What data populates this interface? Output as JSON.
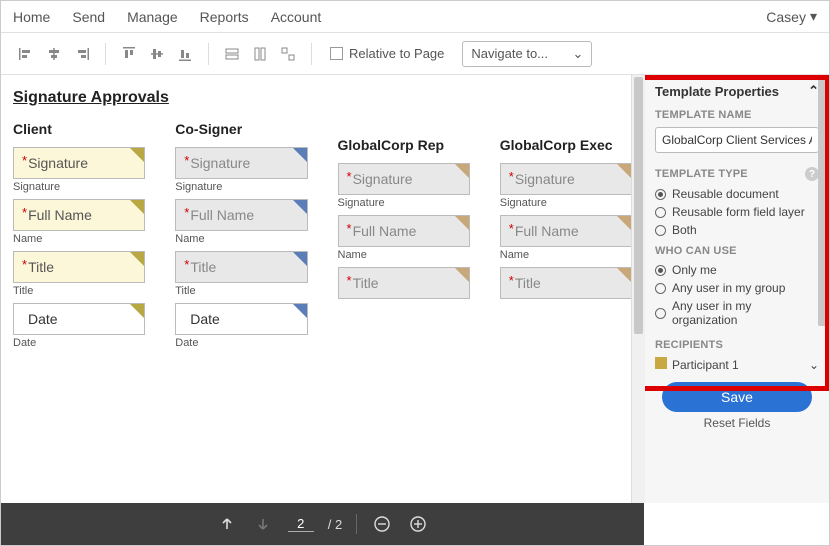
{
  "topnav": {
    "items": [
      "Home",
      "Send",
      "Manage",
      "Reports",
      "Account"
    ],
    "user": "Casey"
  },
  "toolbar": {
    "relative_label": "Relative to Page",
    "navigate_label": "Navigate to..."
  },
  "doc": {
    "section_title": "Signature Approvals",
    "roles": [
      {
        "label": "Client",
        "tone": "yellow",
        "corner": "c-olive",
        "fields": [
          {
            "ph": "Signature",
            "req": true,
            "sub": "Signature"
          },
          {
            "ph": "Full Name",
            "req": true,
            "sub": "Name"
          },
          {
            "ph": "Title",
            "req": true,
            "sub": "Title"
          },
          {
            "ph": "Date",
            "req": false,
            "sub": "Date",
            "tone_override": "white",
            "indent": true
          }
        ]
      },
      {
        "label": "Co-Signer",
        "tone": "grey",
        "corner": "c-blue",
        "fields": [
          {
            "ph": "Signature",
            "req": true,
            "sub": "Signature"
          },
          {
            "ph": "Full Name",
            "req": true,
            "sub": "Name"
          },
          {
            "ph": "Title",
            "req": true,
            "sub": "Title"
          },
          {
            "ph": "Date",
            "req": false,
            "sub": "Date",
            "tone_override": "white",
            "indent": true
          }
        ]
      },
      {
        "label": "GlobalCorp Rep",
        "tone": "grey",
        "corner": "c-tan",
        "fields": [
          {
            "ph": "Signature",
            "req": true,
            "sub": "Signature"
          },
          {
            "ph": "Full Name",
            "req": true,
            "sub": "Name"
          },
          {
            "ph": "Title",
            "req": true,
            "sub": ""
          }
        ]
      },
      {
        "label": "GlobalCorp Exec",
        "tone": "grey",
        "corner": "c-tan",
        "fields": [
          {
            "ph": "Signature",
            "req": true,
            "sub": "Signature"
          },
          {
            "ph": "Full Name",
            "req": true,
            "sub": "Name"
          },
          {
            "ph": "Title",
            "req": true,
            "sub": ""
          }
        ]
      }
    ]
  },
  "panel": {
    "title": "Template Properties",
    "name_label": "TEMPLATE NAME",
    "name_value": "GlobalCorp Client Services A",
    "type_label": "TEMPLATE TYPE",
    "type_options": [
      {
        "label": "Reusable document",
        "selected": true
      },
      {
        "label": "Reusable form field layer",
        "selected": false
      },
      {
        "label": "Both",
        "selected": false
      }
    ],
    "who_label": "WHO CAN USE",
    "who_options": [
      {
        "label": "Only me",
        "selected": true
      },
      {
        "label": "Any user in my group",
        "selected": false
      },
      {
        "label": "Any user in my organization",
        "selected": false
      }
    ],
    "recipients_label": "RECIPIENTS",
    "participant": "Participant 1",
    "save": "Save",
    "reset": "Reset Fields"
  },
  "pager": {
    "current": "2",
    "total": "/ 2"
  }
}
